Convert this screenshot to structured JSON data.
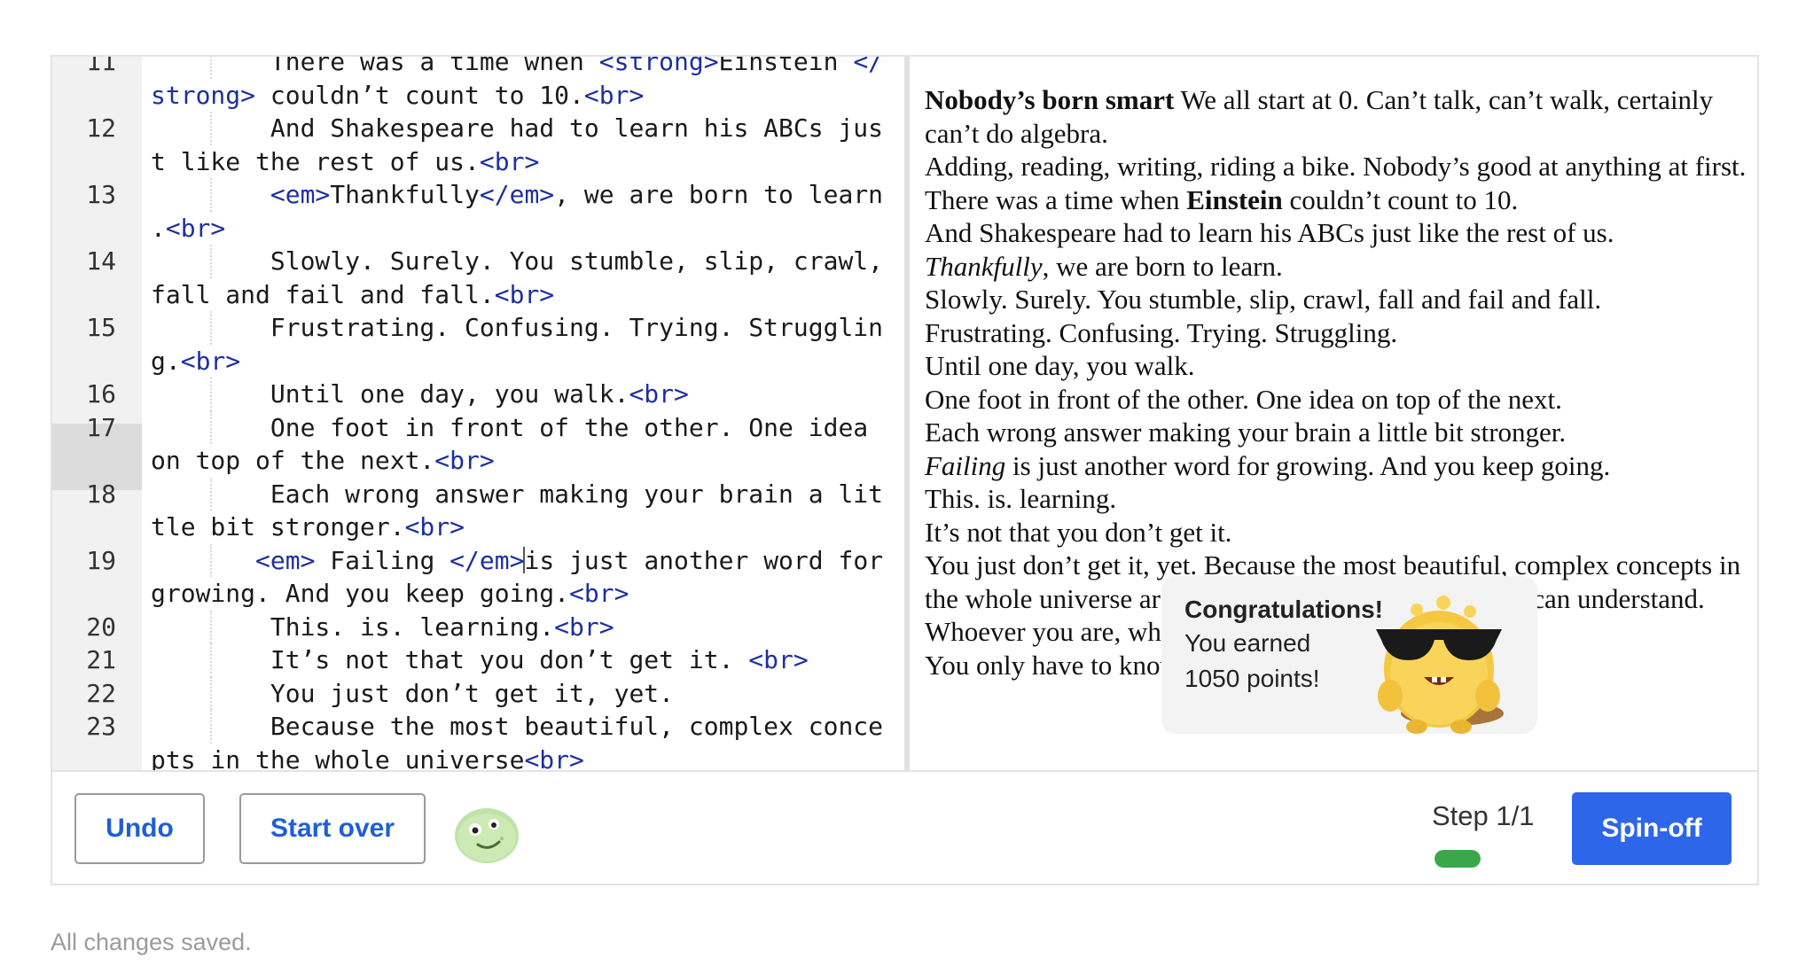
{
  "editor": {
    "lines": [
      {
        "num": "11",
        "parts": [
          {
            "t": "        There was a time when "
          },
          {
            "t": "<strong>",
            "tag": true
          },
          {
            "t": "Einstein "
          },
          {
            "t": "</strong>",
            "tag": true
          },
          {
            "t": " couldn’t count to 10."
          },
          {
            "t": "<br>",
            "tag": true
          }
        ]
      },
      {
        "num": "12",
        "parts": [
          {
            "t": "        And Shakespeare had to learn his ABCs just like the rest of us."
          },
          {
            "t": "<br>",
            "tag": true
          }
        ]
      },
      {
        "num": "13",
        "parts": [
          {
            "t": "        "
          },
          {
            "t": "<em>",
            "tag": true
          },
          {
            "t": "Thankfully"
          },
          {
            "t": "</em>",
            "tag": true
          },
          {
            "t": ", we are born to learn ."
          },
          {
            "t": "<br>",
            "tag": true
          }
        ]
      },
      {
        "num": "14",
        "parts": [
          {
            "t": "        Slowly. Surely. You stumble, slip, crawl, fall and fail and fall."
          },
          {
            "t": "<br>",
            "tag": true
          }
        ]
      },
      {
        "num": "15",
        "parts": [
          {
            "t": "        Frustrating. Confusing. Trying. Struggling."
          },
          {
            "t": "<br>",
            "tag": true
          }
        ]
      },
      {
        "num": "16",
        "parts": [
          {
            "t": "        Until one day, you walk."
          },
          {
            "t": "<br>",
            "tag": true
          }
        ]
      },
      {
        "num": "17",
        "parts": [
          {
            "t": "        One foot in front of the other. One idea on top of the next."
          },
          {
            "t": "<br>",
            "tag": true
          }
        ]
      },
      {
        "num": "18",
        "parts": [
          {
            "t": "        Each wrong answer making your brain a little bit stronger."
          },
          {
            "t": "<br>",
            "tag": true
          }
        ]
      },
      {
        "num": "19",
        "parts": [
          {
            "t": "       "
          },
          {
            "t": "<em>",
            "tag": true
          },
          {
            "t": " Failing "
          },
          {
            "t": "</em>",
            "tag": true
          },
          {
            "cursor": true
          },
          {
            "t": "is just another word for growing. And you keep going."
          },
          {
            "t": "<br>",
            "tag": true
          }
        ]
      },
      {
        "num": "20",
        "parts": [
          {
            "t": "        This. is. learning."
          },
          {
            "t": "<br>",
            "tag": true
          }
        ]
      },
      {
        "num": "21",
        "parts": [
          {
            "t": "        It’s not that you don’t get it. "
          },
          {
            "t": "<br>",
            "tag": true
          }
        ]
      },
      {
        "num": "22",
        "parts": [
          {
            "t": "        You just don’t get it, yet."
          }
        ]
      },
      {
        "num": "23",
        "parts": [
          {
            "t": "        Because the most beautiful, complex concepts in the whole universe"
          },
          {
            "t": "<br>",
            "tag": true
          }
        ]
      }
    ],
    "active_line": "19"
  },
  "preview": {
    "paragraphs": [
      [
        {
          "t": "Nobody’s born smart",
          "b": true
        },
        {
          "t": " We all start at 0. Can’t talk, can’t walk, certainly can’t do algebra."
        }
      ],
      [
        {
          "t": "Adding, reading, writing, riding a bike. Nobody’s good at anything at first."
        }
      ],
      [
        {
          "t": "There was a time when "
        },
        {
          "t": "Einstein",
          "b": true
        },
        {
          "t": " couldn’t count to 10."
        }
      ],
      [
        {
          "t": "And Shakespeare had to learn his ABCs just like the rest of us."
        }
      ],
      [
        {
          "t": "Thankfully",
          "i": true
        },
        {
          "t": ", we are born to learn."
        }
      ],
      [
        {
          "t": "Slowly. Surely. You stumble, slip, crawl, fall and fail and fall."
        }
      ],
      [
        {
          "t": "Frustrating. Confusing. Trying. Struggling."
        }
      ],
      [
        {
          "t": "Until one day, you walk."
        }
      ],
      [
        {
          "t": "One foot in front of the other. One idea on top of the next."
        }
      ],
      [
        {
          "t": "Each wrong answer making your brain a little bit stronger."
        }
      ],
      [
        {
          "t": "Failing",
          "i": true
        },
        {
          "t": " is just another word for growing. And you keep going."
        }
      ],
      [
        {
          "t": "This. is. learning."
        }
      ],
      [
        {
          "t": "It’s not that you don’t get it."
        }
      ],
      [
        {
          "t": "You just don’t get it, yet. Because the most beautiful, complex concepts in the whole universe are built on basic ideas that anyone can understand."
        }
      ],
      [
        {
          "t": "Whoever you are, wherever you’re starting from,"
        }
      ],
      [
        {
          "t": " "
        }
      ],
      [
        {
          "t": "You only have to know one thing:"
        }
      ]
    ]
  },
  "toast": {
    "title": "Congratulations!",
    "line1": "You earned",
    "line2": "1050 points!"
  },
  "footer": {
    "undo_label": "Undo",
    "start_over_label": "Start over",
    "step_label": "Step 1/1",
    "step_progress": 1.0,
    "spinoff_label": "Spin-off"
  },
  "status": {
    "saved": "All changes saved."
  },
  "colors": {
    "accent": "#2d66e8",
    "tag": "#1d2f9e",
    "progress": "#3aa84a"
  }
}
